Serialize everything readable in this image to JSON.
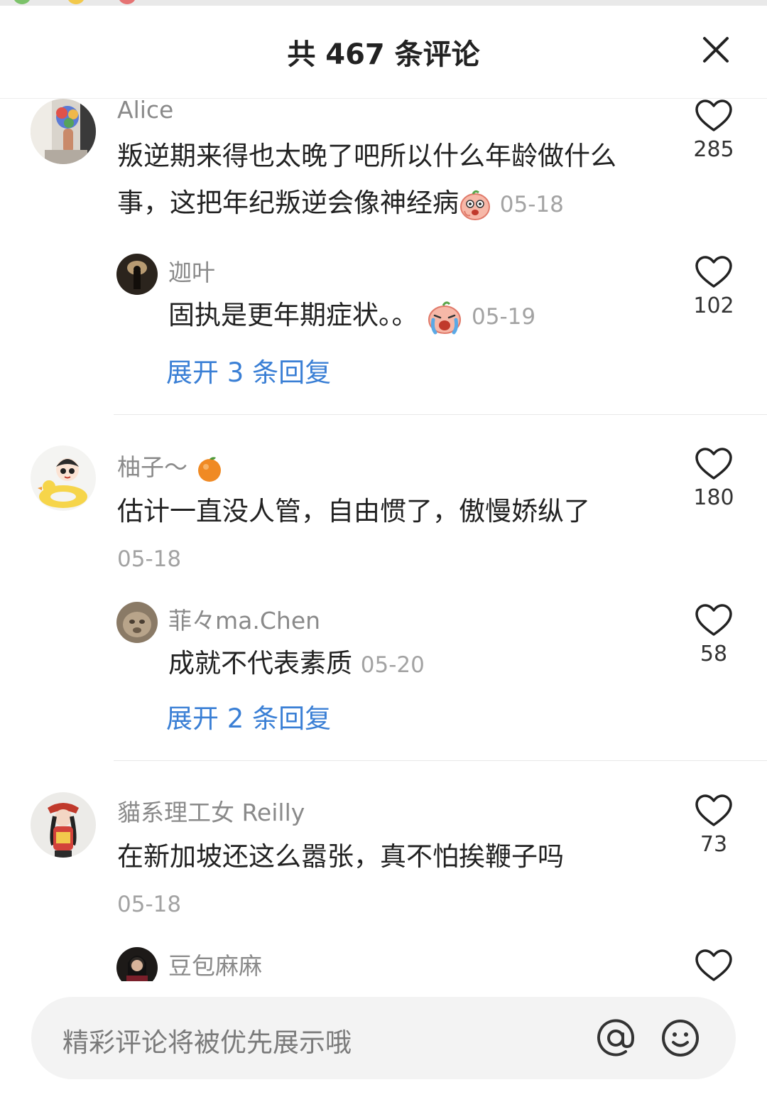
{
  "header": {
    "title": "共 467 条评论"
  },
  "comments": [
    {
      "user": "Alice",
      "text": "叛逆期来得也太晚了吧所以什么年龄做什么事，这把年纪叛逆会像神经病",
      "date": "05-18",
      "likes": "285",
      "reply": {
        "user": "迦叶",
        "text": "固执是更年期症状。。",
        "date": "05-19",
        "likes": "102"
      },
      "expand": "展开 3 条回复"
    },
    {
      "user": "柚子～",
      "text": "估计一直没人管，自由惯了，傲慢娇纵了",
      "date": "05-18",
      "likes": "180",
      "reply": {
        "user": "菲々ma.Chen",
        "text": "成就不代表素质",
        "date": "05-20",
        "likes": "58"
      },
      "expand": "展开 2 条回复"
    },
    {
      "user": "貓系理工女 Reilly",
      "text": "在新加坡还这么嚣张，真不怕挨鞭子吗",
      "date": "05-18",
      "likes": "73",
      "reply": {
        "user": "豆包麻麻"
      }
    }
  ],
  "input": {
    "placeholder": "精彩评论将被优先展示哦"
  },
  "icons": {
    "close": "close-icon",
    "heart": "heart-outline-icon",
    "at": "at-icon",
    "emoji": "smile-icon"
  },
  "colors": {
    "link": "#3a7fd5",
    "username": "#8a8a8a",
    "date": "#a3a3a3",
    "text": "#222222",
    "input_bg": "#f3f3f3"
  }
}
